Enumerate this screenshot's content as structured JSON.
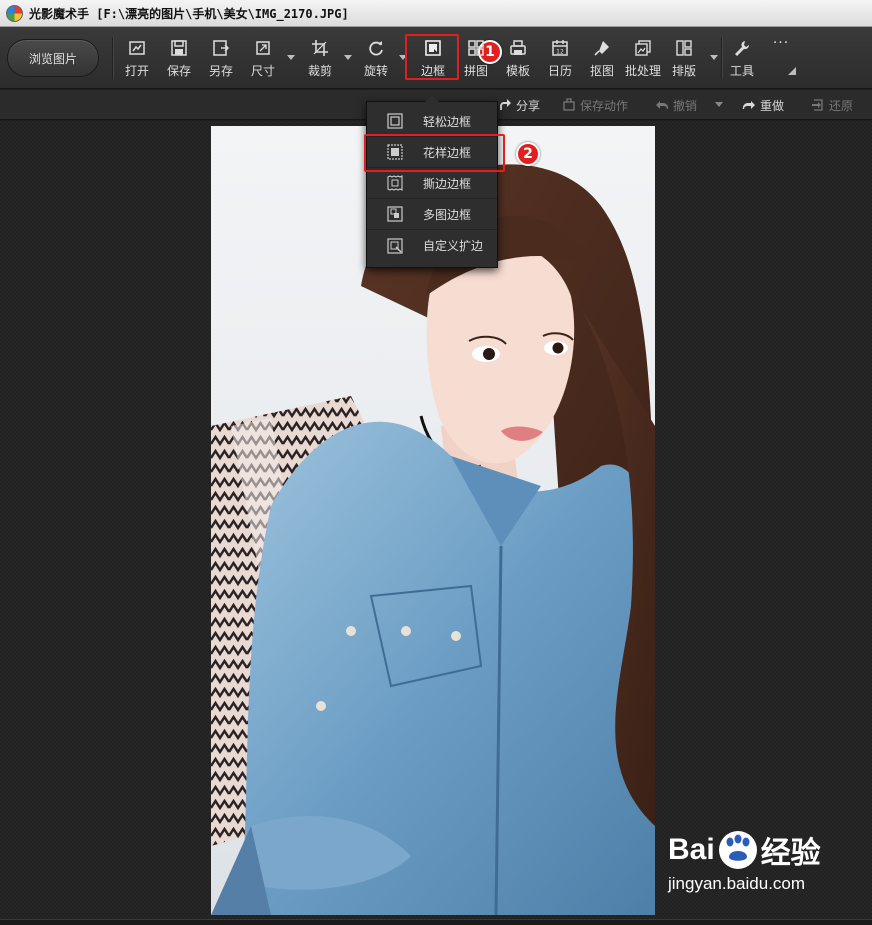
{
  "window": {
    "title": "光影魔术手 [F:\\漂亮的图片\\手机\\美女\\IMG_2170.JPG]"
  },
  "toolbar": {
    "browse_label": "浏览图片",
    "tools": [
      {
        "label": "打开",
        "icon": "open-icon"
      },
      {
        "label": "保存",
        "icon": "save-icon"
      },
      {
        "label": "另存",
        "icon": "save-as-icon"
      },
      {
        "label": "尺寸",
        "icon": "resize-icon"
      },
      {
        "label": "裁剪",
        "icon": "crop-icon"
      },
      {
        "label": "旋转",
        "icon": "rotate-icon"
      },
      {
        "label": "边框",
        "icon": "frame-icon"
      },
      {
        "label": "拼图",
        "icon": "collage-icon"
      },
      {
        "label": "模板",
        "icon": "template-icon"
      },
      {
        "label": "日历",
        "icon": "calendar-icon"
      },
      {
        "label": "抠图",
        "icon": "cutout-icon"
      },
      {
        "label": "批处理",
        "icon": "batch-icon"
      },
      {
        "label": "排版",
        "icon": "layout-icon"
      },
      {
        "label": "工具",
        "icon": "wrench-icon"
      }
    ],
    "more_label": "···"
  },
  "actions": {
    "share": "分享",
    "save_action": "保存动作",
    "undo": "撤销",
    "redo": "重做",
    "restore": "还原"
  },
  "frame_menu": {
    "items": [
      {
        "label": "轻松边框",
        "icon": "simple-frame-icon"
      },
      {
        "label": "花样边框",
        "icon": "fancy-frame-icon"
      },
      {
        "label": "撕边边框",
        "icon": "torn-frame-icon"
      },
      {
        "label": "多图边框",
        "icon": "multi-frame-icon"
      },
      {
        "label": "自定义扩边",
        "icon": "custom-border-icon"
      }
    ]
  },
  "annotations": {
    "step1": "1",
    "step2": "2",
    "color": "#e02020"
  },
  "watermark": {
    "brand_left": "Bai",
    "brand_right": "经验",
    "url": "jingyan.baidu.com"
  }
}
